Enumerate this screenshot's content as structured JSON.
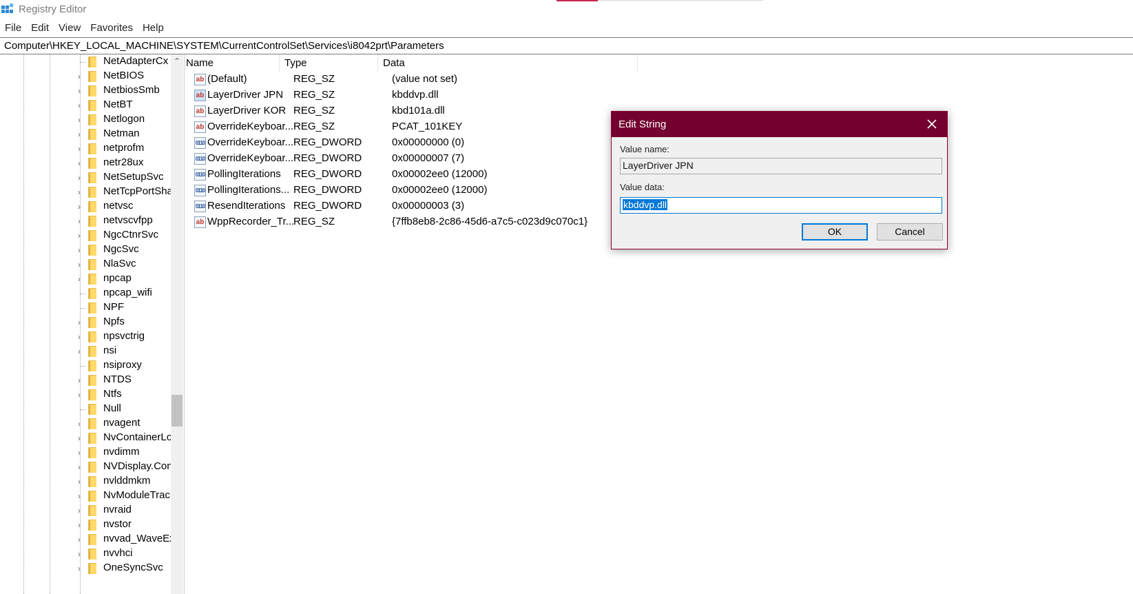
{
  "window": {
    "title": "Registry Editor"
  },
  "menu": [
    "File",
    "Edit",
    "View",
    "Favorites",
    "Help"
  ],
  "address": "Computer\\HKEY_LOCAL_MACHINE\\SYSTEM\\CurrentControlSet\\Services\\i8042prt\\Parameters",
  "tree": {
    "items": [
      {
        "label": "NetAdapterCx",
        "expandable": false
      },
      {
        "label": "NetBIOS",
        "expandable": true
      },
      {
        "label": "NetbiosSmb",
        "expandable": true
      },
      {
        "label": "NetBT",
        "expandable": true
      },
      {
        "label": "Netlogon",
        "expandable": true
      },
      {
        "label": "Netman",
        "expandable": true
      },
      {
        "label": "netprofm",
        "expandable": true
      },
      {
        "label": "netr28ux",
        "expandable": true
      },
      {
        "label": "NetSetupSvc",
        "expandable": true
      },
      {
        "label": "NetTcpPortSha",
        "expandable": true
      },
      {
        "label": "netvsc",
        "expandable": true
      },
      {
        "label": "netvscvfpp",
        "expandable": true
      },
      {
        "label": "NgcCtnrSvc",
        "expandable": true
      },
      {
        "label": "NgcSvc",
        "expandable": true
      },
      {
        "label": "NlaSvc",
        "expandable": true
      },
      {
        "label": "npcap",
        "expandable": true
      },
      {
        "label": "npcap_wifi",
        "expandable": false
      },
      {
        "label": "NPF",
        "expandable": false
      },
      {
        "label": "Npfs",
        "expandable": true
      },
      {
        "label": "npsvctrig",
        "expandable": true
      },
      {
        "label": "nsi",
        "expandable": true
      },
      {
        "label": "nsiproxy",
        "expandable": false
      },
      {
        "label": "NTDS",
        "expandable": true
      },
      {
        "label": "Ntfs",
        "expandable": true
      },
      {
        "label": "Null",
        "expandable": false
      },
      {
        "label": "nvagent",
        "expandable": true
      },
      {
        "label": "NvContainerLo",
        "expandable": true
      },
      {
        "label": "nvdimm",
        "expandable": true
      },
      {
        "label": "NVDisplay.Con",
        "expandable": true
      },
      {
        "label": "nvlddmkm",
        "expandable": true
      },
      {
        "label": "NvModuleTrac",
        "expandable": true
      },
      {
        "label": "nvraid",
        "expandable": true
      },
      {
        "label": "nvstor",
        "expandable": true
      },
      {
        "label": "nvvad_WaveEx",
        "expandable": true
      },
      {
        "label": "nvvhci",
        "expandable": true
      },
      {
        "label": "OneSyncSvc",
        "expandable": true
      }
    ]
  },
  "list": {
    "columns": [
      "Name",
      "Type",
      "Data"
    ],
    "rows": [
      {
        "name": "(Default)",
        "type": "REG_SZ",
        "data": "(value not set)",
        "icon": "string-value-icon"
      },
      {
        "name": "LayerDriver JPN",
        "type": "REG_SZ",
        "data": "kbddvp.dll",
        "icon": "string-value-icon",
        "selected": true
      },
      {
        "name": "LayerDriver KOR",
        "type": "REG_SZ",
        "data": "kbd101a.dll",
        "icon": "string-value-icon"
      },
      {
        "name": "OverrideKeyboar...",
        "type": "REG_SZ",
        "data": "PCAT_101KEY",
        "icon": "string-value-icon"
      },
      {
        "name": "OverrideKeyboar...",
        "type": "REG_DWORD",
        "data": "0x00000000 (0)",
        "icon": "dword-value-icon"
      },
      {
        "name": "OverrideKeyboar...",
        "type": "REG_DWORD",
        "data": "0x00000007 (7)",
        "icon": "dword-value-icon"
      },
      {
        "name": "PollingIterations",
        "type": "REG_DWORD",
        "data": "0x00002ee0 (12000)",
        "icon": "dword-value-icon"
      },
      {
        "name": "PollingIterations...",
        "type": "REG_DWORD",
        "data": "0x00002ee0 (12000)",
        "icon": "dword-value-icon"
      },
      {
        "name": "ResendIterations",
        "type": "REG_DWORD",
        "data": "0x00000003 (3)",
        "icon": "dword-value-icon"
      },
      {
        "name": "WppRecorder_Tr...",
        "type": "REG_SZ",
        "data": "{7ffb8eb8-2c86-45d6-a7c5-c023d9c070c1}",
        "icon": "string-value-icon"
      }
    ]
  },
  "dialog": {
    "title": "Edit String",
    "value_name_label": "Value name:",
    "value_name": "LayerDriver JPN",
    "value_data_label": "Value data:",
    "value_data": "kbddvp.dll",
    "ok_label": "OK",
    "cancel_label": "Cancel",
    "title_color": "#73002e"
  },
  "colors": {
    "selection": "#0078d7",
    "folder": "#ffd96a"
  }
}
